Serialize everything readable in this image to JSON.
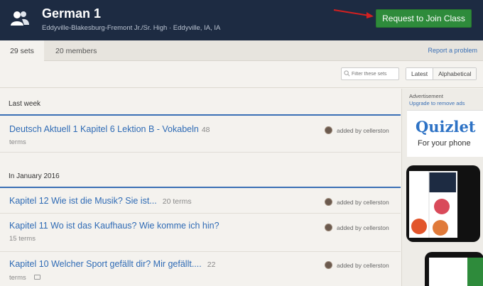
{
  "header": {
    "title": "German 1",
    "subtitle": "Eddyville-Blakesburg-Fremont Jr./Sr. High · Eddyville, IA, IA",
    "join_button": "Request to Join Class"
  },
  "tabs": [
    {
      "label": "29 sets",
      "active": true
    },
    {
      "label": "20 members",
      "active": false
    }
  ],
  "report_link": "Report a problem",
  "filter": {
    "placeholder": "Filter these sets",
    "sort_options": [
      "Latest",
      "Alphabetical"
    ],
    "selected_sort": "Latest"
  },
  "groups": [
    {
      "heading": "Last week",
      "sets": [
        {
          "title": "Deutsch Aktuell 1 Kapitel 6 Lektion B - Vokabeln",
          "count": "48",
          "terms": "terms",
          "added_by": "added by cellerston"
        }
      ]
    },
    {
      "heading": "In January 2016",
      "sets": [
        {
          "title": "Kapitel 12 Wie ist die Musik? Sie ist...",
          "count": "20 terms",
          "terms": "",
          "added_by": "added by cellerston"
        },
        {
          "title": "Kapitel 11 Wo ist das Kaufhaus? Wie komme ich hin?",
          "count": "",
          "terms": "15 terms",
          "added_by": "added by cellerston"
        },
        {
          "title": "Kapitel 10 Welcher Sport gefällt dir? Mir gefällt....",
          "count": "22",
          "terms": "terms",
          "added_by": "added by cellerston"
        }
      ]
    }
  ],
  "sidebar": {
    "ad_label": "Advertisement",
    "upgrade_link": "Upgrade to remove ads",
    "ad_brand": "Quizlet",
    "ad_tagline": "For your phone"
  },
  "colors": {
    "header_bg": "#1d2b42",
    "join_green": "#2e8b3b",
    "link_blue": "#2f6bb5",
    "arrow_red": "#d42020"
  }
}
